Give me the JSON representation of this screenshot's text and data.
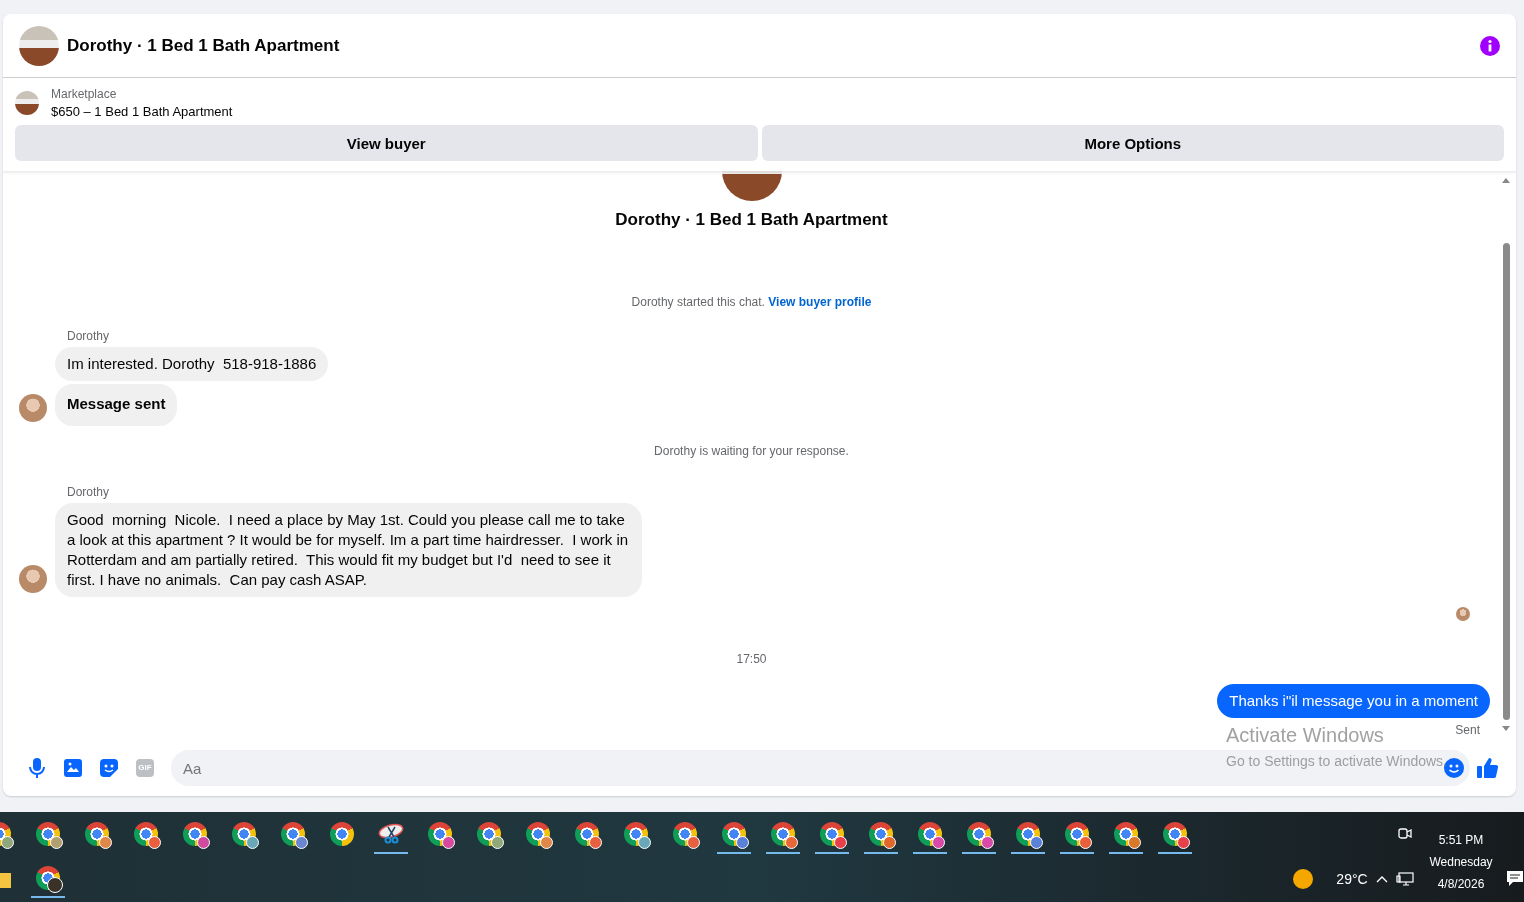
{
  "conversation": {
    "title": "Dorothy · 1 Bed 1 Bath Apartment"
  },
  "listing": {
    "source": "Marketplace",
    "summary": "$650 – 1 Bed 1 Bath Apartment",
    "buttons": [
      "View buyer",
      "More Options"
    ]
  },
  "chat": {
    "title": "Dorothy · 1 Bed 1 Bath Apartment",
    "items": [
      {
        "kind": "system",
        "text": "Dorothy started this chat.",
        "link": "View buyer profile"
      },
      {
        "kind": "incoming",
        "sender": "Dorothy",
        "bubbles": [
          {
            "text": "Im interested. Dorothy  518-918-1886",
            "bold": false
          },
          {
            "text": "Message sent",
            "bold": true
          }
        ]
      },
      {
        "kind": "system",
        "text": "Dorothy is waiting for your response."
      },
      {
        "kind": "incoming",
        "sender": "Dorothy",
        "bubbles": [
          {
            "text": "Good  morning  Nicole.  I need a place by May 1st. Could you please call me to take a look at this apartment ? It would be for myself. Im a part time hairdresser.  I work in Rotterdam and am partially retired.  This would fit my budget but I'd  need to see it first. I have no animals.  Can pay cash ASAP.",
            "bold": false
          }
        ]
      },
      {
        "kind": "read-receipt"
      },
      {
        "kind": "timestamp",
        "text": "17:50"
      },
      {
        "kind": "outgoing",
        "text": "Thanks i\"il message you in a moment",
        "status": "Sent"
      }
    ]
  },
  "composer": {
    "gif_label": "GIF",
    "placeholder": "Aa"
  },
  "os_notice": {
    "title": "Activate Windows",
    "text": "Go to Settings to activate Windows."
  },
  "taskbar": {
    "rows": [
      [
        {
          "kind": "chrome",
          "color": "#8fa67a",
          "running": false
        },
        {
          "kind": "chrome",
          "color": "#b0a070",
          "running": false
        },
        {
          "kind": "chrome",
          "color": "#e0884a",
          "running": false
        },
        {
          "kind": "chrome",
          "color": "#e86040",
          "running": false
        },
        {
          "kind": "chrome",
          "color": "#d04aa0",
          "running": false
        },
        {
          "kind": "chrome",
          "color": "#6aa8b8",
          "running": false
        },
        {
          "kind": "chrome",
          "color": "#6b86d0",
          "running": false
        },
        {
          "kind": "chrome",
          "running": false
        },
        {
          "kind": "snipping-tool",
          "running": true
        },
        {
          "kind": "chrome",
          "color": "#d84aa0",
          "running": false
        },
        {
          "kind": "chrome",
          "color": "#8fa87a",
          "running": false
        },
        {
          "kind": "chrome",
          "color": "#e0884a",
          "running": false
        },
        {
          "kind": "chrome",
          "color": "#e86040",
          "running": false
        },
        {
          "kind": "chrome",
          "color": "#6aa8b8",
          "running": false
        },
        {
          "kind": "chrome",
          "color": "#e86040",
          "running": false
        },
        {
          "kind": "chrome",
          "color": "#5b80d8",
          "running": true
        },
        {
          "kind": "chrome",
          "color": "#e8683a",
          "running": true
        },
        {
          "kind": "chrome",
          "color": "#e8404a",
          "running": true
        },
        {
          "kind": "chrome",
          "color": "#e0682a",
          "running": true
        },
        {
          "kind": "chrome",
          "color": "#d84aa8",
          "running": true
        },
        {
          "kind": "chrome",
          "color": "#d84aa8",
          "running": true
        },
        {
          "kind": "chrome",
          "color": "#5b80d8",
          "running": true
        },
        {
          "kind": "chrome",
          "color": "#e8603a",
          "running": true
        },
        {
          "kind": "chrome",
          "color": "#d8782a",
          "running": true
        },
        {
          "kind": "chrome",
          "color": "#e8404a",
          "running": true
        }
      ],
      [
        {
          "kind": "folder",
          "running": false
        },
        {
          "kind": "chrome-photo",
          "running": true
        }
      ]
    ],
    "weather": {
      "temperature": "29°C"
    },
    "clock": {
      "time": "5:51 PM",
      "day": "Wednesday",
      "date": "4/8/2026"
    }
  }
}
